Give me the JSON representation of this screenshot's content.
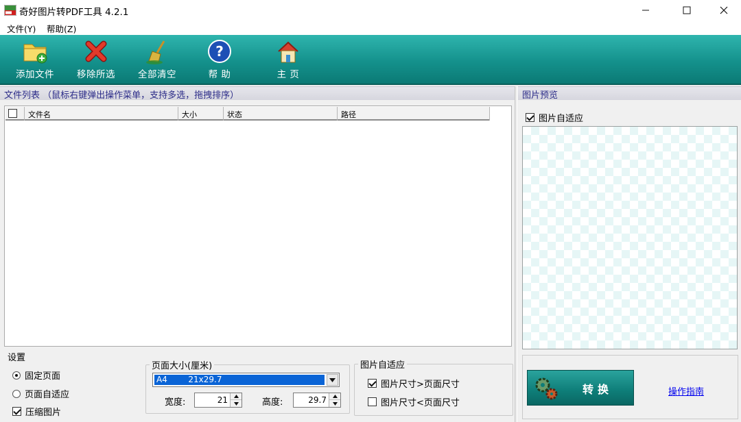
{
  "window": {
    "title": "奇好图片转PDF工具 4.2.1",
    "icon": "pdf-app-icon",
    "controls": [
      "minimize-icon",
      "maximize-icon",
      "close-icon"
    ]
  },
  "menu": {
    "file": "文件(Y)",
    "help": "帮助(Z)"
  },
  "toolbar": {
    "add_files": "添加文件",
    "remove_selected": "移除所选",
    "clear_all": "全部清空",
    "help": "帮 助",
    "home": "主 页"
  },
  "file_list": {
    "header": "文件列表  （鼠标右键弹出操作菜单，支持多选，拖拽排序）",
    "columns": [
      "文件名",
      "大小",
      "状态",
      "路径"
    ]
  },
  "preview": {
    "header": "图片预览",
    "auto_fit_label": "图片自适应",
    "auto_fit_checked": true
  },
  "settings": {
    "title": "设置",
    "fixed_page": "固定页面",
    "adaptive_page": "页面自适应",
    "selected_mode": "固定页面",
    "compress": "压缩图片",
    "compress_checked": true
  },
  "page_size": {
    "title": "页面大小(厘米)",
    "selected": "A4        21x29.7",
    "width_label": "宽度:",
    "width_value": "21",
    "height_label": "高度:",
    "height_value": "29.7"
  },
  "image_fit": {
    "title": "图片自适应",
    "larger": "图片尺寸>页面尺寸",
    "larger_checked": true,
    "smaller": "图片尺寸<页面尺寸",
    "smaller_checked": false
  },
  "actions": {
    "convert": "转换",
    "guide": "操作指南"
  },
  "colors": {
    "toolbar": "#14918c",
    "convert_button": "#0e7d78",
    "link": "#0000ee",
    "selection": "#0a64d6"
  }
}
